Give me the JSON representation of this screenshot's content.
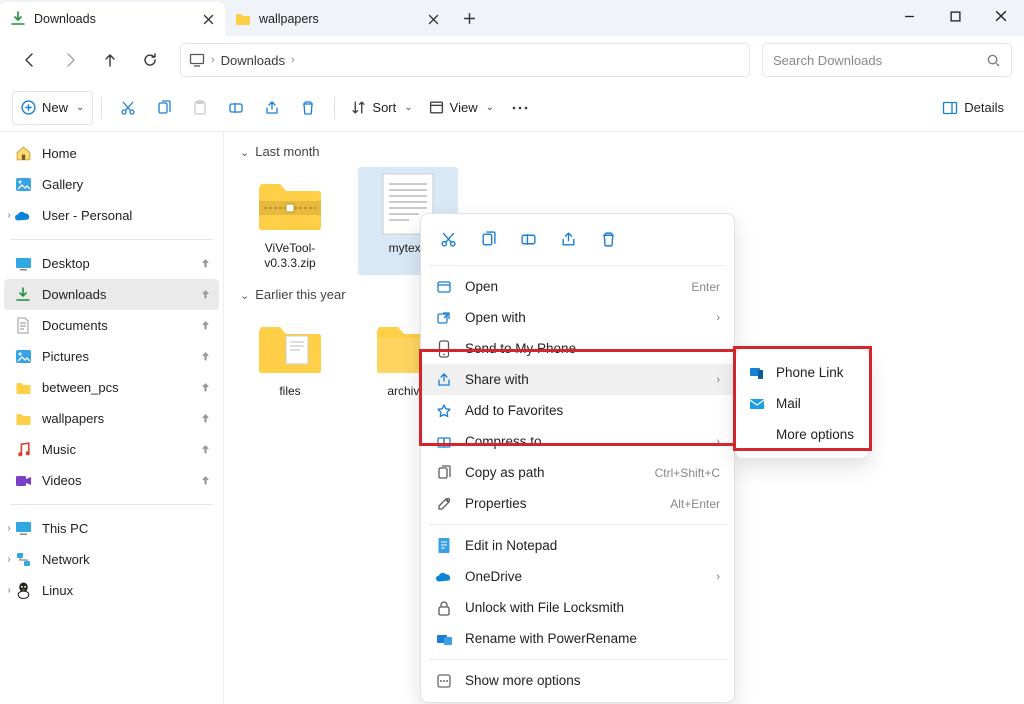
{
  "tabs": [
    {
      "label": "Downloads",
      "active": true
    },
    {
      "label": "wallpapers",
      "active": false
    }
  ],
  "nav": {
    "breadcrumb": [
      "Downloads"
    ],
    "search_placeholder": "Search Downloads"
  },
  "toolbar": {
    "new": "New",
    "sort": "Sort",
    "view": "View",
    "details": "Details"
  },
  "sidebar": {
    "top": [
      {
        "label": "Home",
        "icon": "home"
      },
      {
        "label": "Gallery",
        "icon": "gallery"
      },
      {
        "label": "User - Personal",
        "icon": "onedrive",
        "expandable": true
      }
    ],
    "quick": [
      {
        "label": "Desktop",
        "icon": "desktop"
      },
      {
        "label": "Downloads",
        "icon": "downloads",
        "active": true
      },
      {
        "label": "Documents",
        "icon": "documents"
      },
      {
        "label": "Pictures",
        "icon": "pictures"
      },
      {
        "label": "between_pcs",
        "icon": "folder"
      },
      {
        "label": "wallpapers",
        "icon": "folder"
      },
      {
        "label": "Music",
        "icon": "music"
      },
      {
        "label": "Videos",
        "icon": "videos"
      }
    ],
    "bottom": [
      {
        "label": "This PC",
        "icon": "thispc",
        "expandable": true
      },
      {
        "label": "Network",
        "icon": "network",
        "expandable": true
      },
      {
        "label": "Linux",
        "icon": "linux",
        "expandable": true
      }
    ]
  },
  "content": {
    "groups": [
      {
        "header": "Last month",
        "items": [
          {
            "name": "ViVeTool-v0.3.3.zip",
            "kind": "zip"
          },
          {
            "name": "mytext.",
            "kind": "text",
            "selected": true
          }
        ]
      },
      {
        "header": "Earlier this year",
        "items": [
          {
            "name": "files",
            "kind": "folder-docs"
          },
          {
            "name": "archival",
            "kind": "folder"
          }
        ]
      }
    ]
  },
  "context_menu": {
    "items": [
      {
        "label": "Open",
        "hint": "Enter",
        "icon": "open"
      },
      {
        "label": "Open with",
        "arrow": true,
        "icon": "openwith"
      },
      {
        "label": "Send to My Phone",
        "icon": "phone"
      },
      {
        "label": "Share with",
        "arrow": true,
        "icon": "share",
        "hover": true
      },
      {
        "label": "Add to Favorites",
        "icon": "star"
      },
      {
        "label": "Compress to...",
        "arrow": true,
        "icon": "compress"
      },
      {
        "label": "Copy as path",
        "hint": "Ctrl+Shift+C",
        "icon": "copypath"
      },
      {
        "label": "Properties",
        "hint": "Alt+Enter",
        "icon": "properties"
      }
    ],
    "items2": [
      {
        "label": "Edit in Notepad",
        "icon": "notepad"
      },
      {
        "label": "OneDrive",
        "arrow": true,
        "icon": "onedrive"
      },
      {
        "label": "Unlock with File Locksmith",
        "icon": "lock"
      },
      {
        "label": "Rename with PowerRename",
        "icon": "rename"
      }
    ],
    "more": "Show more options"
  },
  "sub_menu": {
    "items": [
      {
        "label": "Phone Link",
        "icon": "phonelink"
      },
      {
        "label": "Mail",
        "icon": "mail"
      },
      {
        "label": "More options"
      }
    ]
  }
}
